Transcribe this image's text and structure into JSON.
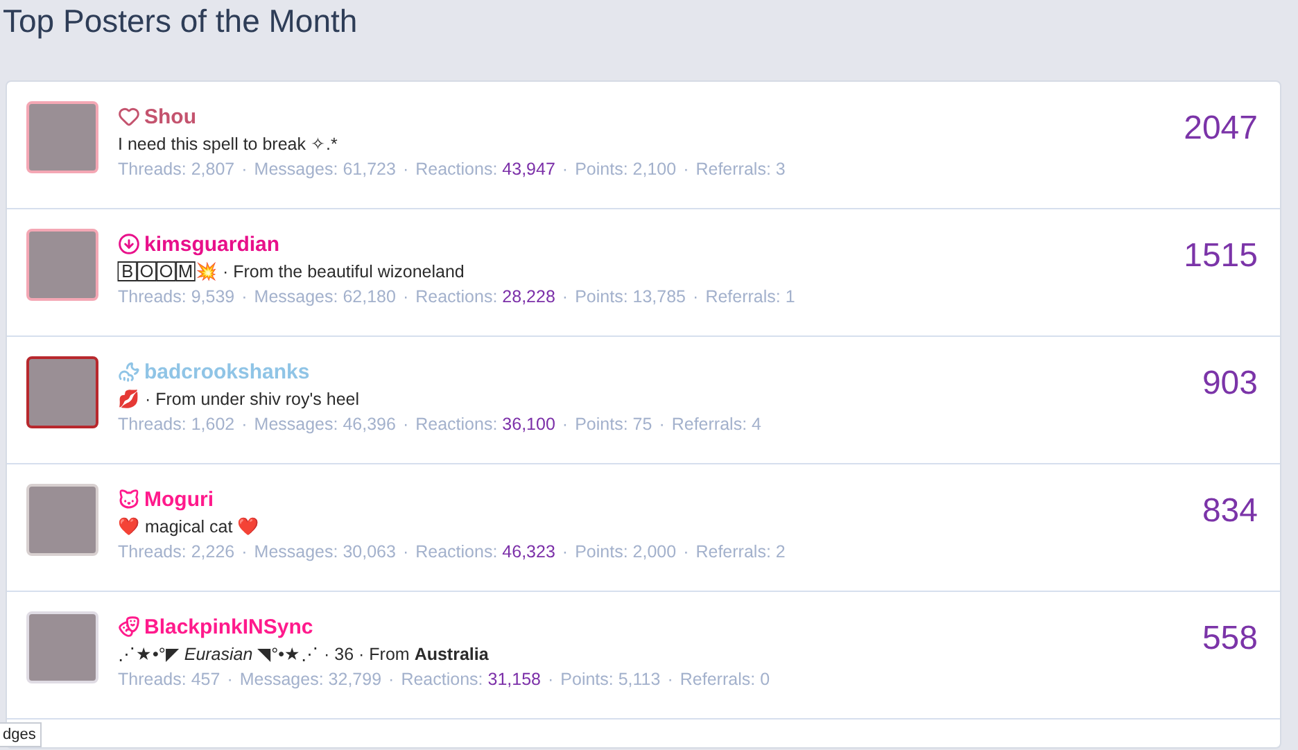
{
  "title": "Top Posters of the Month",
  "members": [
    {
      "name": "Shou",
      "color": "#c4536e",
      "tagline": "I need this spell to break ✧.*",
      "stats": [
        {
          "label": "Threads:",
          "value": "2,807",
          "accent": false
        },
        {
          "label": "Messages:",
          "value": "61,723",
          "accent": false
        },
        {
          "label": "Reactions:",
          "value": "43,947",
          "accent": true
        },
        {
          "label": "Points:",
          "value": "2,100",
          "accent": false
        },
        {
          "label": "Referrals:",
          "value": "3",
          "accent": false
        }
      ],
      "score": "2047"
    },
    {
      "name": "kimsguardian",
      "color": "#e8108a",
      "tagline": "🄱🄾🄾🄼💥 · From the beautiful wizoneland",
      "stats": [
        {
          "label": "Threads:",
          "value": "9,539",
          "accent": false
        },
        {
          "label": "Messages:",
          "value": "62,180",
          "accent": false
        },
        {
          "label": "Reactions:",
          "value": "28,228",
          "accent": true
        },
        {
          "label": "Points:",
          "value": "13,785",
          "accent": false
        },
        {
          "label": "Referrals:",
          "value": "1",
          "accent": false
        }
      ],
      "score": "1515"
    },
    {
      "name": "badcrookshanks",
      "color": "#8fc4e6",
      "tagline": "💋 · From under shiv roy's heel",
      "stats": [
        {
          "label": "Threads:",
          "value": "1,602",
          "accent": false
        },
        {
          "label": "Messages:",
          "value": "46,396",
          "accent": false
        },
        {
          "label": "Reactions:",
          "value": "36,100",
          "accent": true
        },
        {
          "label": "Points:",
          "value": "75",
          "accent": false
        },
        {
          "label": "Referrals:",
          "value": "4",
          "accent": false
        }
      ],
      "score": "903"
    },
    {
      "name": "Moguri",
      "color": "#ff1a8c",
      "tagline": "❤️ magical cat ❤️",
      "stats": [
        {
          "label": "Threads:",
          "value": "2,226",
          "accent": false
        },
        {
          "label": "Messages:",
          "value": "30,063",
          "accent": false
        },
        {
          "label": "Reactions:",
          "value": "46,323",
          "accent": true
        },
        {
          "label": "Points:",
          "value": "2,000",
          "accent": false
        },
        {
          "label": "Referrals:",
          "value": "2",
          "accent": false
        }
      ],
      "score": "834"
    },
    {
      "name": "BlackpinkINSync",
      "color": "#ff1a8c",
      "tagline": "⋰★•°◤ *Eurasian* ◥°•★⋰ · 36 · From **Australia**",
      "stats": [
        {
          "label": "Threads:",
          "value": "457",
          "accent": false
        },
        {
          "label": "Messages:",
          "value": "32,799",
          "accent": false
        },
        {
          "label": "Reactions:",
          "value": "31,158",
          "accent": true
        },
        {
          "label": "Points:",
          "value": "5,113",
          "accent": false
        },
        {
          "label": "Referrals:",
          "value": "0",
          "accent": false
        }
      ],
      "score": "558"
    }
  ],
  "stat_separator": "·",
  "tooltip": "dges"
}
